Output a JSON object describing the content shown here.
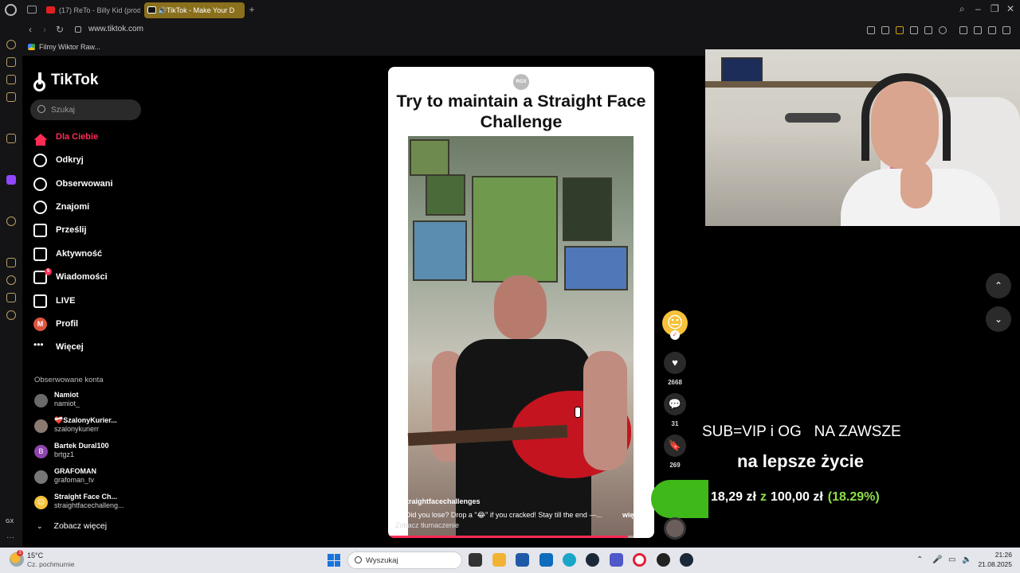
{
  "browser": {
    "tabs": [
      {
        "label": "(17) ReTo - Billy Kid (prod"
      },
      {
        "label": "TikTok - Make Your D"
      }
    ],
    "url": "www.tiktok.com",
    "bookmark_label": "Filmy Wiktor Raw..."
  },
  "tiktok": {
    "logo": "TikTok",
    "search_placeholder": "Szukaj",
    "nav": [
      {
        "label": "Dla Ciebie",
        "icon": "home-icon"
      },
      {
        "label": "Odkryj",
        "icon": "compass-icon"
      },
      {
        "label": "Obserwowani",
        "icon": "following-icon"
      },
      {
        "label": "Znajomi",
        "icon": "friends-icon"
      },
      {
        "label": "Prześlij",
        "icon": "upload-icon"
      },
      {
        "label": "Aktywność",
        "icon": "activity-icon"
      },
      {
        "label": "Wiadomości",
        "icon": "messages-icon",
        "badge": "5"
      },
      {
        "label": "LIVE",
        "icon": "live-icon"
      },
      {
        "label": "Profil",
        "icon": "profile-avatar",
        "avatar_letter": "M"
      },
      {
        "label": "Więcej",
        "icon": "more-icon"
      }
    ],
    "followed_title": "Obserwowane konta",
    "followed": [
      {
        "name": "Namiot",
        "handle": "namiot_",
        "avatar": ""
      },
      {
        "name": "❤️‍🩹SzalonyKurier...",
        "handle": "szalonykurierr",
        "avatar": ""
      },
      {
        "name": "Bartek Dural100",
        "handle": "brtgz1",
        "avatar": "B"
      },
      {
        "name": "GRAFOMAN",
        "handle": "grafoman_tv",
        "avatar": ""
      },
      {
        "name": "Straight Face Ch...",
        "handle": "straightfacechalleng...",
        "avatar": "😐"
      }
    ],
    "see_more": "Zobacz więcej"
  },
  "video": {
    "watermark": "RGX",
    "title": "Try to maintain a Straight Face Challenge",
    "author": "straightfacechallenges",
    "caption": "😐 Did you lose? Drop a \"😂\" if you cracked! Stay till the end —...",
    "more_label": "więcej",
    "translate_label": "Zobacz tłumaczenie",
    "progress": 0.9,
    "avatar_emoji": "😐",
    "follow_check": "✓",
    "like_count": "2668",
    "comment_count": "31",
    "save_count": "269",
    "accent_color": "#fe2c55"
  },
  "overlay": {
    "line1": "SUB=VIP i OG   NA ZAWSZE",
    "line2": "na lepsze życie",
    "goal_current": "18,29 zł",
    "goal_sep": "z",
    "goal_target": "100,00 zł",
    "goal_percent": "(18.29%)",
    "goal_fraction": 0.1829
  },
  "taskbar": {
    "weather_temp": "15°C",
    "weather_desc": "Cz. pochmurnie",
    "weather_badge": "3",
    "search_placeholder": "Wyszukaj",
    "time": "21:26",
    "date": "21.08.2025"
  }
}
